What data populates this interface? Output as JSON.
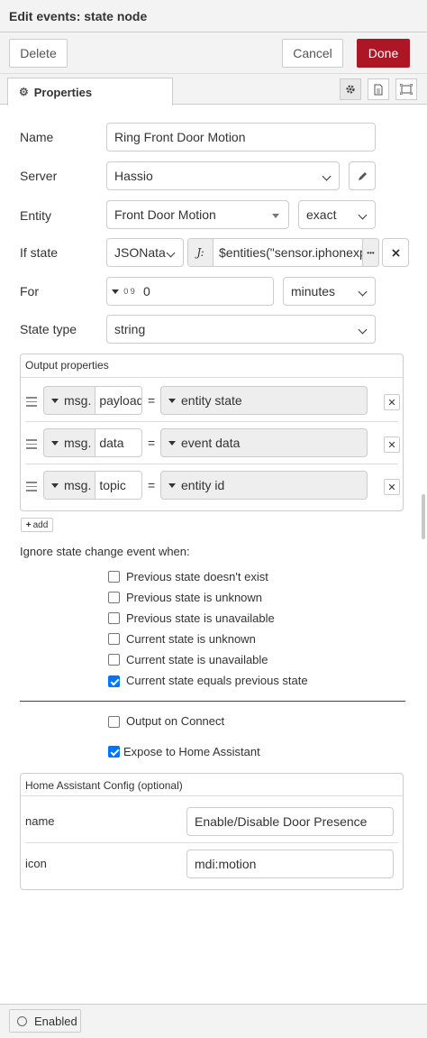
{
  "dialog": {
    "title": "Edit events: state node"
  },
  "toolbar": {
    "delete_label": "Delete",
    "cancel_label": "Cancel",
    "done_label": "Done"
  },
  "tabs": {
    "properties_label": "Properties"
  },
  "form": {
    "name": {
      "label": "Name",
      "value": "Ring Front Door Motion"
    },
    "server": {
      "label": "Server",
      "value": "Hassio"
    },
    "entity": {
      "label": "Entity",
      "value": "Front Door Motion",
      "match_mode": "exact"
    },
    "if_state": {
      "label": "If state",
      "type": "JSONata",
      "type_icon": "J:",
      "value": "$entities(\"sensor.iphonexpr",
      "more": "•••"
    },
    "for": {
      "label": "For",
      "type_icon": "0 9",
      "value": "0",
      "unit": "minutes"
    },
    "state_type": {
      "label": "State type",
      "value": "string"
    }
  },
  "output_properties": {
    "legend": "Output properties",
    "rows": [
      {
        "prefix": "msg.",
        "property": "payload",
        "eq": "=",
        "value": "entity state"
      },
      {
        "prefix": "msg.",
        "property": "data",
        "eq": "=",
        "value": "event data"
      },
      {
        "prefix": "msg.",
        "property": "topic",
        "eq": "=",
        "value": "entity id"
      }
    ],
    "add_label": "add"
  },
  "ignore": {
    "heading": "Ignore state change event when:",
    "options": [
      {
        "label": "Previous state doesn't exist",
        "checked": false
      },
      {
        "label": "Previous state is unknown",
        "checked": false
      },
      {
        "label": "Previous state is unavailable",
        "checked": false
      },
      {
        "label": "Current state is unknown",
        "checked": false
      },
      {
        "label": "Current state is unavailable",
        "checked": false
      },
      {
        "label": "Current state equals previous state",
        "checked": true
      }
    ]
  },
  "output_on_connect": {
    "label": "Output on Connect",
    "checked": false
  },
  "expose": {
    "label": "Expose to Home Assistant",
    "checked": true
  },
  "ha_config": {
    "legend": "Home Assistant Config (optional)",
    "rows": [
      {
        "label": "name",
        "value": "Enable/Disable Door Presence"
      },
      {
        "label": "icon",
        "value": "mdi:motion"
      }
    ]
  },
  "footer": {
    "enabled_label": "Enabled"
  }
}
